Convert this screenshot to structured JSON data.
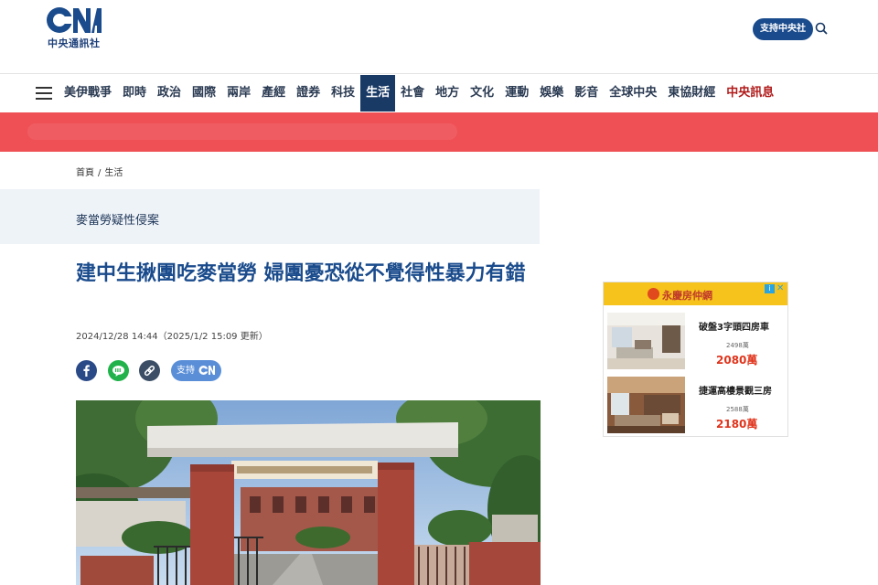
{
  "header": {
    "logo_text": "中央通訊社",
    "support_label": "支持中央社"
  },
  "nav": {
    "items": [
      {
        "label": "美伊戰爭",
        "active": false
      },
      {
        "label": "即時",
        "active": false
      },
      {
        "label": "政治",
        "active": false
      },
      {
        "label": "國際",
        "active": false
      },
      {
        "label": "兩岸",
        "active": false
      },
      {
        "label": "產經",
        "active": false
      },
      {
        "label": "證券",
        "active": false
      },
      {
        "label": "科技",
        "active": false
      },
      {
        "label": "生活",
        "active": true
      },
      {
        "label": "社會",
        "active": false
      },
      {
        "label": "地方",
        "active": false
      },
      {
        "label": "文化",
        "active": false
      },
      {
        "label": "運動",
        "active": false
      },
      {
        "label": "娛樂",
        "active": false
      },
      {
        "label": "影音",
        "active": false
      },
      {
        "label": "全球中央",
        "active": false
      },
      {
        "label": "東協財經",
        "active": false
      },
      {
        "label": "中央訊息",
        "active": false
      }
    ]
  },
  "breadcrumb": {
    "home": "首頁",
    "separator": "/",
    "section": "生活"
  },
  "topic": {
    "label": "麥當勞疑性侵案"
  },
  "article": {
    "title": "建中生揪團吃麥當勞 婦團憂恐從不覺得性暴力有錯",
    "dateline": "2024/12/28 14:44（2025/1/2 15:09 更新）",
    "support_label": "支持"
  },
  "ad": {
    "brand": "永慶房仲網",
    "info_label": "i",
    "close_label": "✕",
    "items": [
      {
        "name": "破盤3字頭四房車",
        "old_price": "2498萬",
        "price": "2080萬"
      },
      {
        "name": "捷運高樓景觀三房",
        "old_price": "2588萬",
        "price": "2180萬"
      }
    ]
  },
  "colors": {
    "brand_blue": "#1a4b8c",
    "nav_active": "#1a3a66",
    "banner_red": "#ee5055",
    "ad_yellow": "#f6c21c"
  }
}
